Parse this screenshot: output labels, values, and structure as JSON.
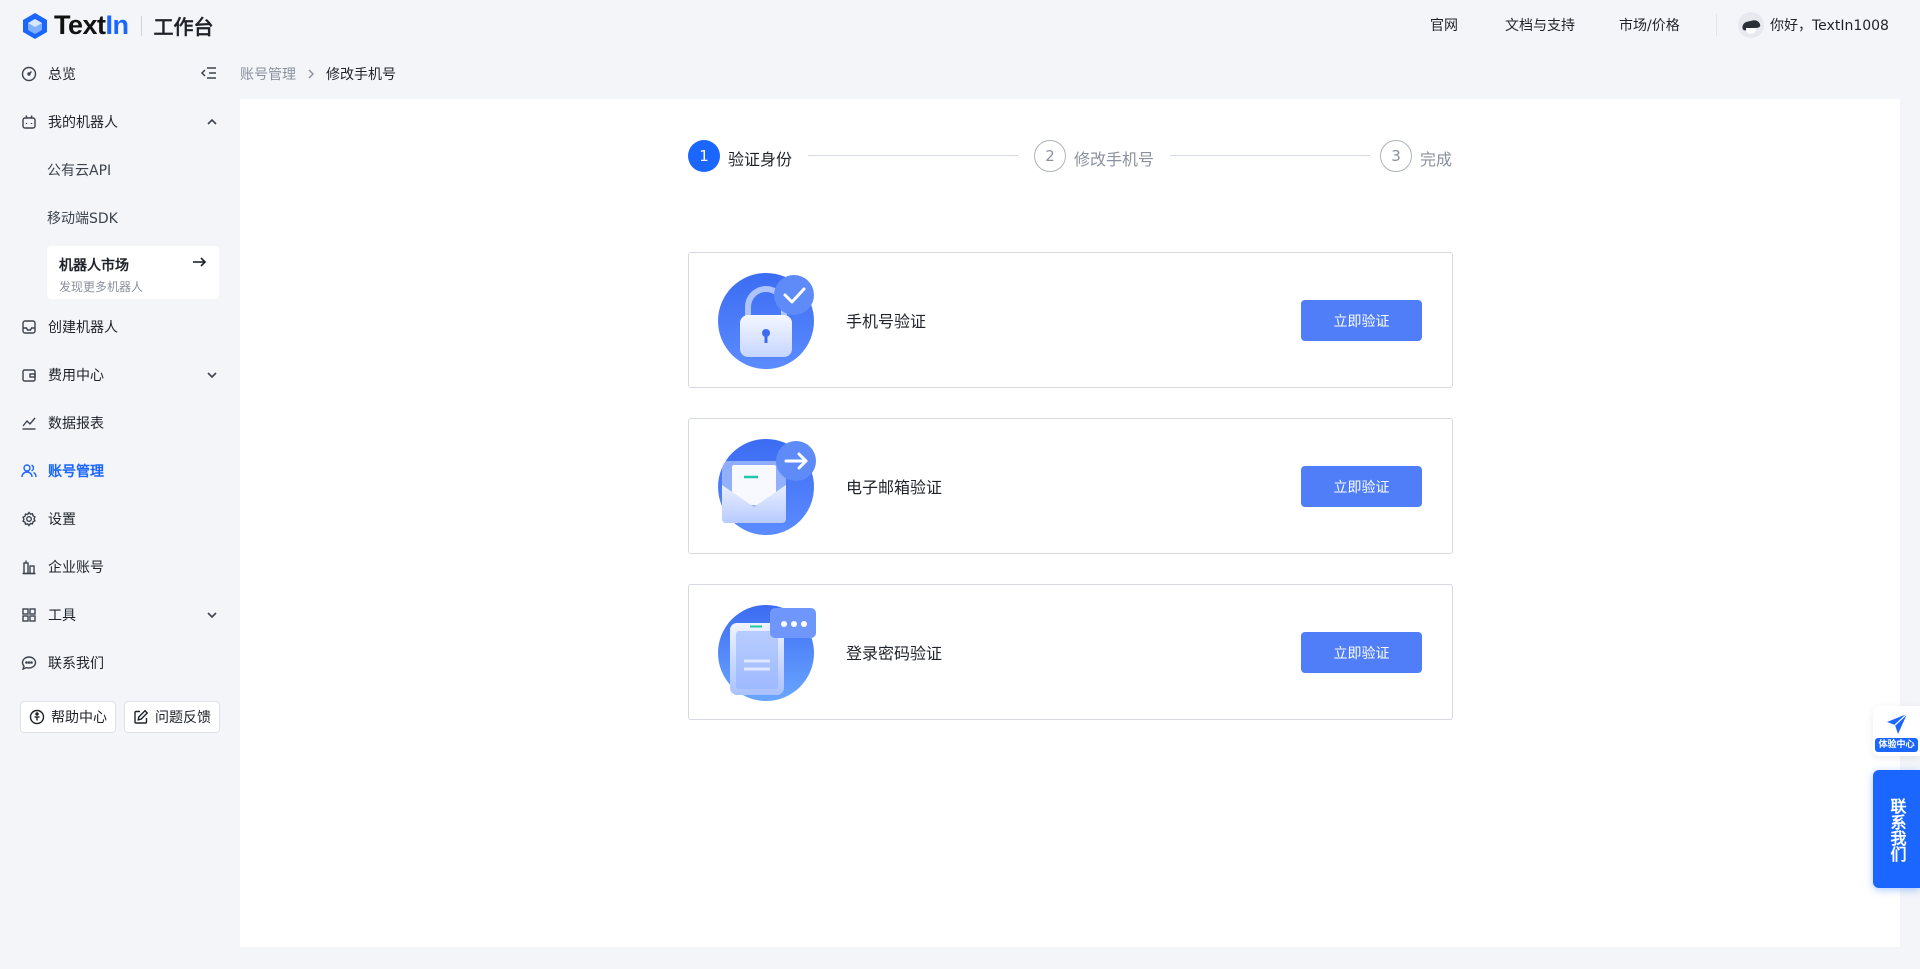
{
  "header": {
    "logo_text": "Text",
    "logo_text_accent": "In",
    "workspace_title": "工作台",
    "nav": [
      "官网",
      "文档与支持",
      "市场/价格"
    ],
    "user_greeting": "你好，TextIn1008"
  },
  "sidebar": {
    "items": {
      "overview": "总览",
      "my_robots": "我的机器人",
      "public_api": "公有云API",
      "mobile_sdk": "移动端SDK",
      "create_robot": "创建机器人",
      "billing": "费用中心",
      "reports": "数据报表",
      "account": "账号管理",
      "settings": "设置",
      "enterprise": "企业账号",
      "tools": "工具",
      "contact": "联系我们"
    },
    "market": {
      "title": "机器人市场",
      "subtitle": "发现更多机器人"
    },
    "help_button": "帮助中心",
    "feedback_button": "问题反馈"
  },
  "breadcrumb": {
    "parent": "账号管理",
    "current": "修改手机号"
  },
  "steps": [
    {
      "number": "1",
      "label": "验证身份",
      "state": "active"
    },
    {
      "number": "2",
      "label": "修改手机号",
      "state": "todo"
    },
    {
      "number": "3",
      "label": "完成",
      "state": "todo"
    }
  ],
  "verify_options": [
    {
      "title": "手机号验证",
      "button": "立即验证",
      "icon": "lock-check-icon"
    },
    {
      "title": "电子邮箱验证",
      "button": "立即验证",
      "icon": "envelope-arrow-icon"
    },
    {
      "title": "登录密码验证",
      "button": "立即验证",
      "icon": "phone-password-icon"
    }
  ],
  "floating": {
    "experience_center": "体验中心",
    "contact_us": "联系我们"
  },
  "colors": {
    "accent": "#1a66ff",
    "button": "#4f7ef8",
    "background": "#f3f5f9"
  }
}
